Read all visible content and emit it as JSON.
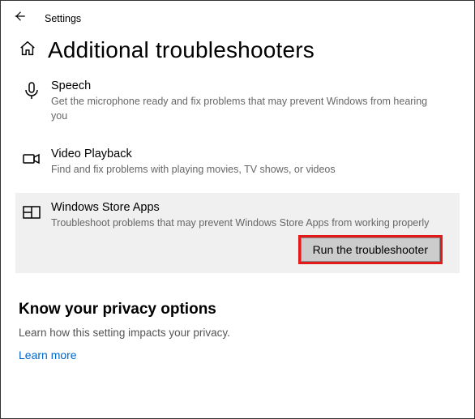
{
  "app_title": "Settings",
  "page_title": "Additional troubleshooters",
  "items": [
    {
      "title": "Speech",
      "desc": "Get the microphone ready and fix problems that may prevent Windows from hearing you"
    },
    {
      "title": "Video Playback",
      "desc": "Find and fix problems with playing movies, TV shows, or videos"
    },
    {
      "title": "Windows Store Apps",
      "desc": "Troubleshoot problems that may prevent Windows Store Apps from working properly"
    }
  ],
  "run_button": "Run the troubleshooter",
  "privacy": {
    "title": "Know your privacy options",
    "desc": "Learn how this setting impacts your privacy.",
    "link": "Learn more"
  }
}
